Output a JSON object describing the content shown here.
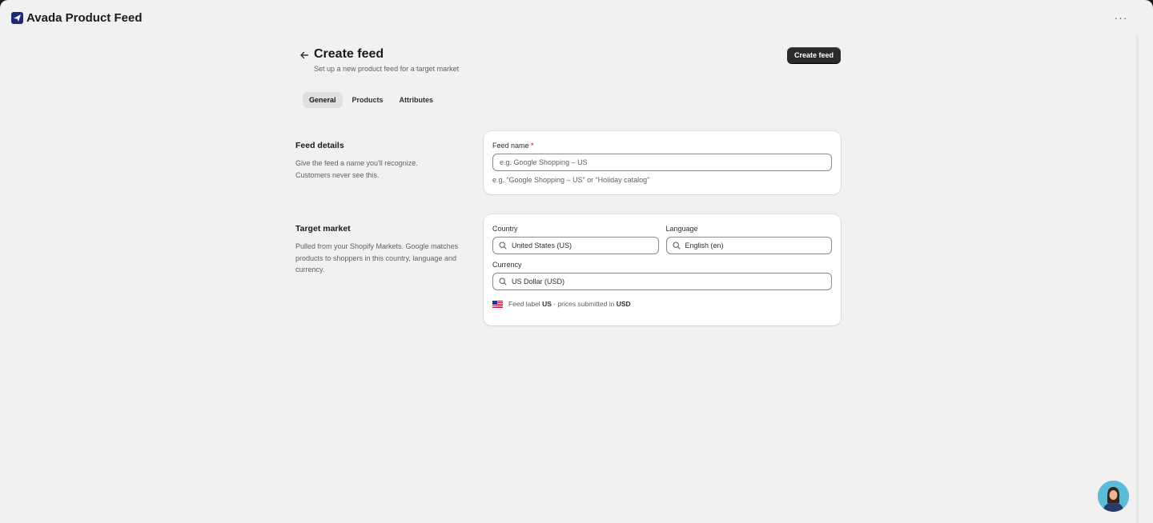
{
  "app": {
    "title": "Avada Product Feed",
    "brand_color": "#1e2a78"
  },
  "header": {
    "title": "Create feed",
    "subtitle": "Set up a new product feed for a target market",
    "primary_action": "Create feed"
  },
  "tabs": [
    {
      "label": "General",
      "active": true
    },
    {
      "label": "Products",
      "active": false
    },
    {
      "label": "Attributes",
      "active": false
    }
  ],
  "feed_details": {
    "title": "Feed details",
    "description": "Give the feed a name you'll recognize. Customers never see this.",
    "name_label": "Feed name",
    "required_mark": "*",
    "name_placeholder": "e.g. Google Shopping – US",
    "name_help": "e.g. “Google Shopping – US” or “Holiday catalog”"
  },
  "target_market": {
    "title": "Target market",
    "description": "Pulled from your Shopify Markets. Google matches products to shoppers in this country, language and currency.",
    "country_label": "Country",
    "country_value": "United States (US)",
    "language_label": "Language",
    "language_value": "English (en)",
    "currency_label": "Currency",
    "currency_value": "US Dollar (USD)",
    "feed_label_prefix": "Feed label",
    "feed_label_code": "US",
    "feed_label_middle": "· prices submitted in",
    "feed_label_currency": "USD"
  }
}
